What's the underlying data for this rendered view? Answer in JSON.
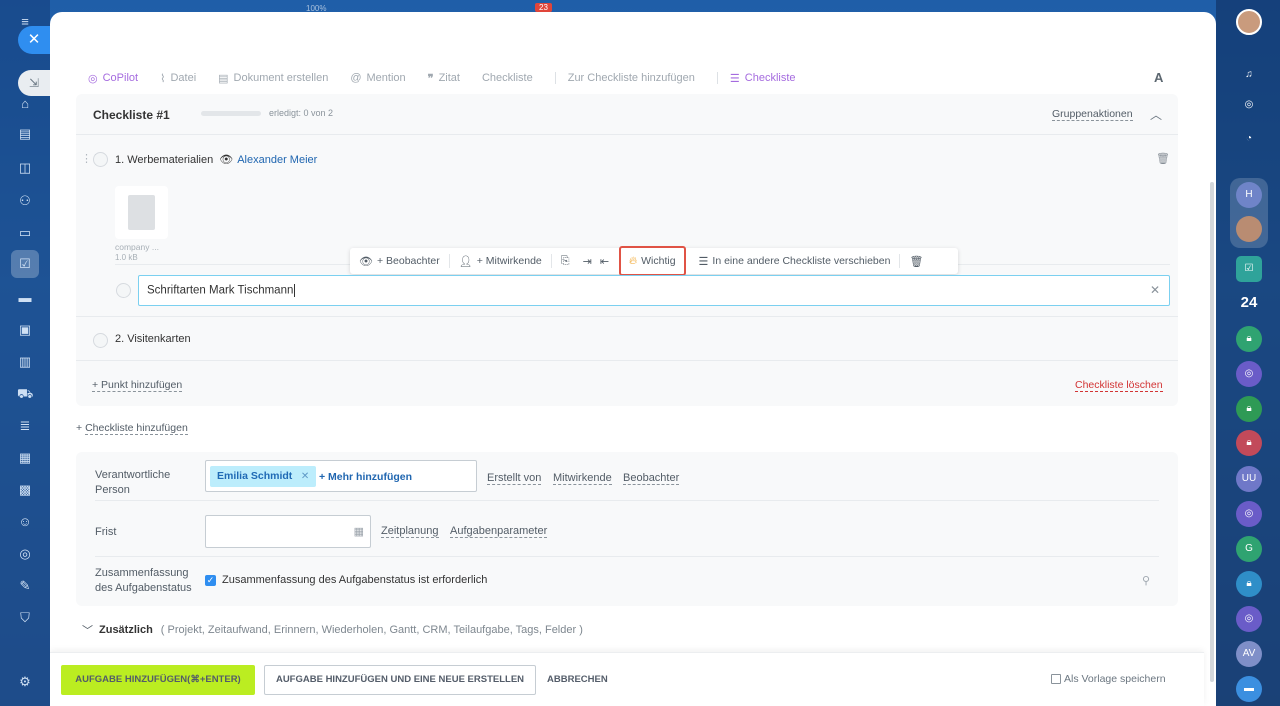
{
  "background": {
    "top_zoom": "100%",
    "top_badge": "23",
    "right_rail": {
      "counter": "24",
      "avatars": [
        "H",
        "UU",
        "G",
        "AV"
      ]
    }
  },
  "toolbar": {
    "items": [
      {
        "label": "CoPilot",
        "icon": "copilot-icon"
      },
      {
        "label": "Datei",
        "icon": "paperclip-icon"
      },
      {
        "label": "Dokument erstellen",
        "icon": "document-icon"
      },
      {
        "label": "Mention",
        "icon": "at-icon"
      },
      {
        "label": "Zitat",
        "icon": "quote-icon"
      },
      {
        "label": "Checkliste"
      },
      {
        "label": "Zur Checkliste hinzufügen"
      },
      {
        "label": "Checkliste",
        "icon": "checklist-icon"
      }
    ],
    "font_button": "A"
  },
  "checklist": {
    "title": "Checkliste #1",
    "progress_text": "erledigt: 0 von 2",
    "group_actions": "Gruppenaktionen",
    "item1": {
      "label": "1. Werbematerialien",
      "watcher": "Alexander Meier"
    },
    "file": {
      "name": "company ...",
      "size": "1.0 kB"
    },
    "popup": {
      "observers": "+ Beobachter",
      "participants": "+ Mitwirkende",
      "important": "Wichtig",
      "move": "In eine andere Checkliste verschieben"
    },
    "edit_value": "Schriftarten Mark Tischmann",
    "item2": "2. Visitenkarten",
    "add_point": "+ Punkt hinzufügen",
    "delete": "Checkliste löschen"
  },
  "add_checklist_prefix": "+ ",
  "add_checklist": "Checkliste hinzufügen",
  "fields": {
    "responsible_label_1": "Verantwortliche",
    "responsible_label_2": "Person",
    "responsible_value": "Emilia Schmidt",
    "add_more": "+ Mehr hinzufügen",
    "created_by": "Erstellt von",
    "participants": "Mitwirkende",
    "observers": "Beobachter",
    "deadline_label": "Frist",
    "planning": "Zeitplanung",
    "task_params": "Aufgabenparameter",
    "summary_label_1": "Zusammenfassung",
    "summary_label_2": "des Aufgabenstatus",
    "summary_checkbox": "Zusammenfassung des Aufgabenstatus ist erforderlich",
    "summary_checked": true
  },
  "extra": {
    "title": "Zusätzlich",
    "list": "( Projekt,  Zeitaufwand,  Erinnern,  Wiederholen,  Gantt,  CRM,  Teilaufgabe,  Tags,  Felder )"
  },
  "footer": {
    "primary": "AUFGABE HINZUFÜGEN(⌘+ENTER)",
    "secondary": "AUFGABE HINZUFÜGEN UND EINE NEUE ERSTELLEN",
    "cancel": "ABBRECHEN",
    "template": "Als Vorlage speichern"
  },
  "colors": {
    "accent_blue": "#2066b0",
    "primary_button": "#bbed21",
    "highlight_red": "#e05345",
    "delete_red": "#d23434",
    "copilot_purple": "#a56bdf"
  }
}
